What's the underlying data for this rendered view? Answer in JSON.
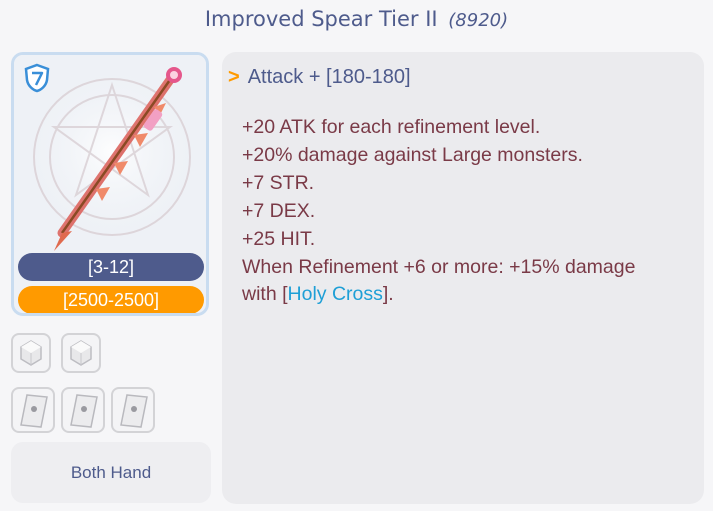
{
  "title": {
    "name": "Improved Spear Tier II",
    "id": "(8920)"
  },
  "item": {
    "type_icon": "shield-icon",
    "image": "spear-icon",
    "slots_label": "[3-12]",
    "price_label": "[2500-2500]",
    "hand_label": "Both Hand"
  },
  "card_slots": {
    "row1": [
      "gem-slot-icon",
      "gem-slot-icon"
    ],
    "row2": [
      "card-slot-icon",
      "card-slot-icon",
      "card-slot-icon"
    ]
  },
  "description": {
    "attack_chevron": ">",
    "attack_text": "Attack + [180-180]",
    "lines": [
      "+20 ATK for each refinement level.",
      "+20% damage against Large monsters.",
      "+7 STR.",
      "+7 DEX.",
      "+25 HIT.",
      "When Refinement +6 or more: +15% damage"
    ],
    "last_line_prefix": "with [",
    "skill_name": "Holy Cross",
    "last_line_suffix": "]."
  },
  "colors": {
    "accent": "#4e5b8c",
    "orange": "#ff9a00",
    "description_text": "#7a3a47",
    "skill_link": "#1e9fd6"
  }
}
